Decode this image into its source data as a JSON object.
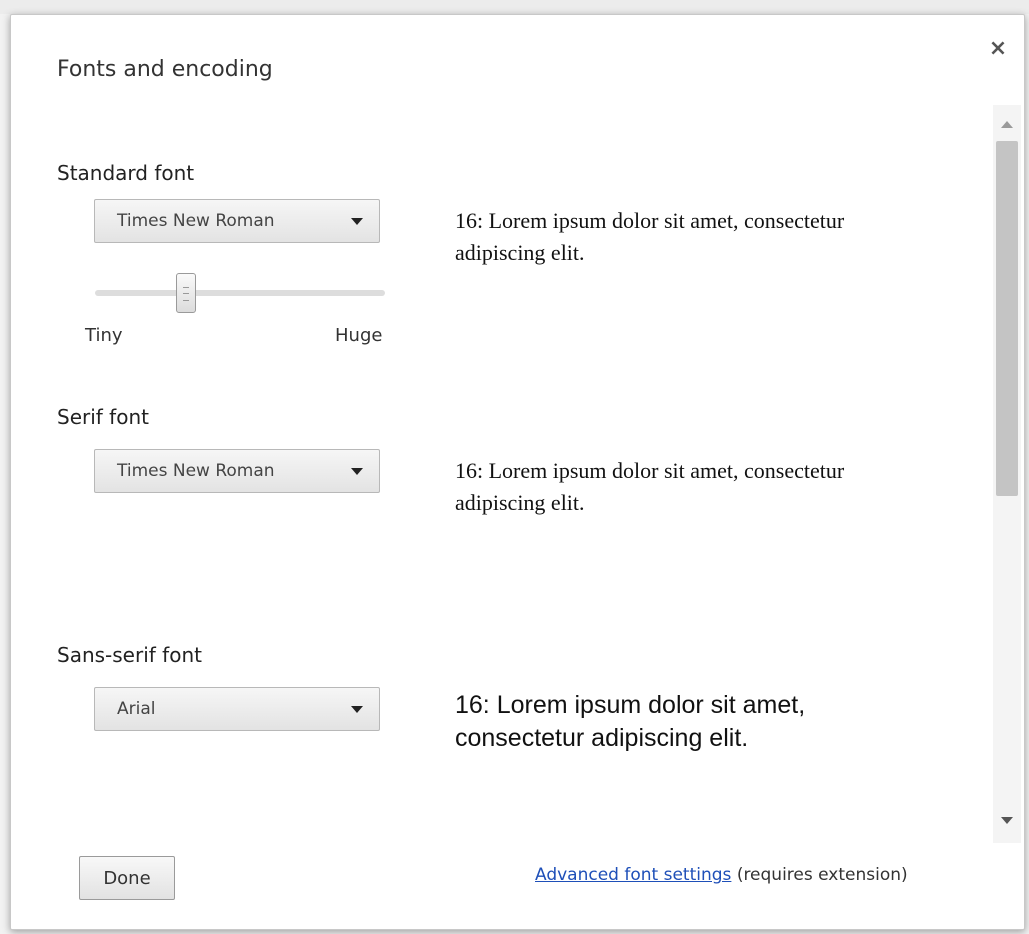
{
  "dialog": {
    "title": "Fonts and encoding",
    "close_glyph": "×"
  },
  "standard_font": {
    "label": "Standard font",
    "selected": "Times New Roman",
    "preview": "16: Lorem ipsum dolor sit amet, consectetur adipiscing elit."
  },
  "font_size_slider": {
    "min_label": "Tiny",
    "max_label": "Huge",
    "level": 0.3
  },
  "serif_font": {
    "label": "Serif font",
    "selected": "Times New Roman",
    "preview": "16: Lorem ipsum dolor sit amet, consectetur adipiscing elit."
  },
  "sans_serif_font": {
    "label": "Sans-serif font",
    "selected": "Arial",
    "preview": "16: Lorem ipsum dolor sit amet, consectetur adipiscing elit."
  },
  "footer": {
    "done_label": "Done",
    "link_text": "Advanced font settings",
    "link_suffix": "(requires extension)"
  },
  "icons": {
    "close": "close-icon",
    "dropdown": "chevron-down-icon",
    "scroll_up": "scroll-up-arrow-icon",
    "scroll_down": "scroll-down-arrow-icon"
  },
  "colors": {
    "link": "#1e4fb8",
    "dialog_bg": "#ffffff",
    "backdrop": "#f2f2f2"
  }
}
